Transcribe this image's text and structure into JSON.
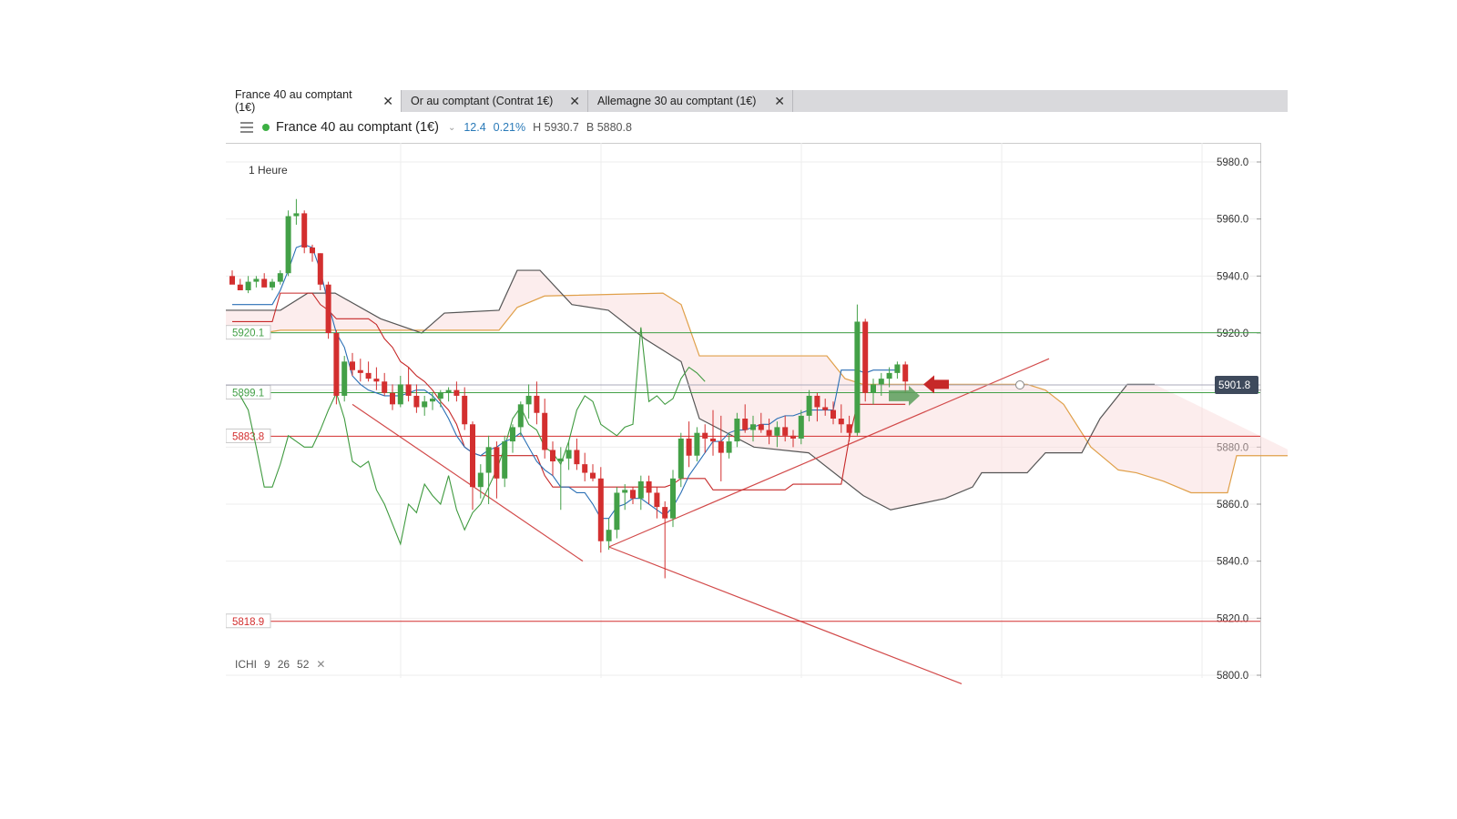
{
  "tabs": [
    {
      "label": "France 40 au comptant (1€)",
      "active": true
    },
    {
      "label": "Or au comptant (Contrat 1€)",
      "active": false
    },
    {
      "label": "Allemagne 30 au comptant (1€)",
      "active": false
    }
  ],
  "toolbar": {
    "symbol": "France 40 au comptant (1€)",
    "change": "12.4",
    "change_pct": "0.21%",
    "high_label": "H",
    "high": "5930.7",
    "bid_label": "B",
    "bid": "5880.8",
    "status_color": "#3cb043"
  },
  "period": "1 Heure",
  "indicator": {
    "name": "ICHI",
    "p1": "9",
    "p2": "26",
    "p3": "52"
  },
  "colors": {
    "up": "#43a047",
    "down": "#d32f2f",
    "accent": "#2a7ab8",
    "price_tag": "#3e4a5c"
  },
  "chart_data": {
    "type": "candlestick",
    "ylim": [
      5800,
      5980
    ],
    "yticks": [
      "5800.0",
      "5820.0",
      "5840.0",
      "5860.0",
      "5880.0",
      "5900.0",
      "5920.0",
      "5940.0",
      "5960.0",
      "5980.0"
    ],
    "current_price": "5901.8",
    "levels": [
      {
        "label": "5920.1",
        "value": 5920.1,
        "color": "#43a047"
      },
      {
        "label": "5899.1",
        "value": 5899.1,
        "color": "#43a047"
      },
      {
        "label": "5883.8",
        "value": 5883.8,
        "color": "#d32f2f"
      },
      {
        "label": "5818.9",
        "value": 5818.9,
        "color": "#d32f2f"
      }
    ],
    "candles": [
      [
        5940,
        5942,
        5938,
        5937
      ],
      [
        5937,
        5939,
        5935,
        5935
      ],
      [
        5935,
        5940,
        5934,
        5938
      ],
      [
        5938,
        5940,
        5936,
        5939
      ],
      [
        5939,
        5941,
        5937,
        5936
      ],
      [
        5936,
        5939,
        5935,
        5938
      ],
      [
        5938,
        5942,
        5937,
        5941
      ],
      [
        5941,
        5963,
        5940,
        5961
      ],
      [
        5961,
        5967,
        5958,
        5962
      ],
      [
        5962,
        5963,
        5948,
        5950
      ],
      [
        5950,
        5951,
        5945,
        5948
      ],
      [
        5948,
        5948,
        5935,
        5937
      ],
      [
        5937,
        5938,
        5918,
        5920
      ],
      [
        5920,
        5921,
        5895,
        5898
      ],
      [
        5898,
        5912,
        5896,
        5910
      ],
      [
        5910,
        5913,
        5905,
        5907
      ],
      [
        5907,
        5911,
        5903,
        5906
      ],
      [
        5906,
        5910,
        5903,
        5904
      ],
      [
        5904,
        5908,
        5900,
        5903
      ],
      [
        5903,
        5906,
        5898,
        5899
      ],
      [
        5899,
        5902,
        5893,
        5895
      ],
      [
        5895,
        5905,
        5894,
        5902
      ],
      [
        5902,
        5908,
        5896,
        5898
      ],
      [
        5898,
        5902,
        5892,
        5894
      ],
      [
        5894,
        5898,
        5891,
        5896
      ],
      [
        5896,
        5899,
        5893,
        5897
      ],
      [
        5897,
        5900,
        5894,
        5899
      ],
      [
        5899,
        5901,
        5896,
        5900
      ],
      [
        5900,
        5903,
        5896,
        5898
      ],
      [
        5898,
        5901,
        5886,
        5888
      ],
      [
        5888,
        5889,
        5858,
        5866
      ],
      [
        5866,
        5874,
        5862,
        5871
      ],
      [
        5871,
        5884,
        5860,
        5880
      ],
      [
        5880,
        5882,
        5862,
        5869
      ],
      [
        5869,
        5884,
        5866,
        5882
      ],
      [
        5882,
        5888,
        5878,
        5887
      ],
      [
        5887,
        5896,
        5884,
        5895
      ],
      [
        5895,
        5902,
        5890,
        5898
      ],
      [
        5898,
        5903,
        5888,
        5892
      ],
      [
        5892,
        5897,
        5876,
        5879
      ],
      [
        5879,
        5882,
        5870,
        5875
      ],
      [
        5875,
        5880,
        5858,
        5876
      ],
      [
        5876,
        5882,
        5872,
        5879
      ],
      [
        5879,
        5883,
        5872,
        5874
      ],
      [
        5874,
        5878,
        5868,
        5871
      ],
      [
        5871,
        5874,
        5868,
        5869
      ],
      [
        5869,
        5873,
        5843,
        5847
      ],
      [
        5847,
        5855,
        5844,
        5851
      ],
      [
        5851,
        5866,
        5848,
        5864
      ],
      [
        5864,
        5867,
        5858,
        5865
      ],
      [
        5865,
        5866,
        5860,
        5862
      ],
      [
        5862,
        5870,
        5858,
        5868
      ],
      [
        5868,
        5870,
        5860,
        5864
      ],
      [
        5864,
        5866,
        5855,
        5859
      ],
      [
        5859,
        5861,
        5834,
        5855
      ],
      [
        5855,
        5872,
        5852,
        5869
      ],
      [
        5869,
        5885,
        5866,
        5883
      ],
      [
        5883,
        5889,
        5873,
        5877
      ],
      [
        5877,
        5887,
        5875,
        5885
      ],
      [
        5885,
        5888,
        5878,
        5883
      ],
      [
        5883,
        5893,
        5877,
        5882
      ],
      [
        5882,
        5891,
        5868,
        5878
      ],
      [
        5878,
        5885,
        5876,
        5882
      ],
      [
        5882,
        5892,
        5880,
        5890
      ],
      [
        5890,
        5895,
        5885,
        5886
      ],
      [
        5886,
        5891,
        5882,
        5888
      ],
      [
        5888,
        5892,
        5885,
        5886
      ],
      [
        5886,
        5890,
        5881,
        5884
      ],
      [
        5884,
        5889,
        5880,
        5887
      ],
      [
        5887,
        5891,
        5882,
        5884
      ],
      [
        5884,
        5886,
        5880,
        5883
      ],
      [
        5883,
        5893,
        5881,
        5891
      ],
      [
        5891,
        5900,
        5889,
        5898
      ],
      [
        5898,
        5899,
        5889,
        5894
      ],
      [
        5894,
        5897,
        5891,
        5893
      ],
      [
        5893,
        5896,
        5888,
        5890
      ],
      [
        5890,
        5895,
        5885,
        5888
      ],
      [
        5888,
        5891,
        5882,
        5885
      ],
      [
        5885,
        5930,
        5884,
        5924
      ],
      [
        5924,
        5925,
        5896,
        5899
      ],
      [
        5899,
        5904,
        5895,
        5902
      ],
      [
        5902,
        5906,
        5898,
        5904
      ],
      [
        5904,
        5908,
        5901,
        5906
      ],
      [
        5906,
        5910,
        5904,
        5909
      ],
      [
        5909,
        5910,
        5899,
        5903
      ]
    ],
    "tenkan": [
      5930,
      5930,
      5930,
      5930,
      5930,
      5930,
      5935,
      5942,
      5950,
      5951,
      5950,
      5942,
      5930,
      5920,
      5915,
      5905,
      5902,
      5900,
      5899,
      5898,
      5898,
      5898,
      5899,
      5900,
      5900,
      5898,
      5895,
      5890,
      5884,
      5880,
      5878,
      5877,
      5879,
      5880,
      5882,
      5883,
      5885,
      5880,
      5875,
      5872,
      5870,
      5866,
      5866,
      5864,
      5864,
      5860,
      5855,
      5855,
      5859,
      5860,
      5862,
      5862,
      5860,
      5858,
      5856,
      5859,
      5864,
      5870,
      5874,
      5878,
      5882,
      5882,
      5885,
      5886,
      5886,
      5887,
      5888,
      5888,
      5890,
      5891,
      5891,
      5892,
      5893,
      5893,
      5893,
      5893,
      5907,
      5907,
      5907,
      5906,
      5907,
      5907,
      5907,
      5907
    ],
    "kijun": [
      5924,
      5924,
      5924,
      5924,
      5924,
      5924,
      5934,
      5934,
      5934,
      5934,
      5934,
      5930,
      5928,
      5925,
      5925,
      5925,
      5925,
      5925,
      5923,
      5918,
      5915,
      5910,
      5908,
      5905,
      5903,
      5900,
      5896,
      5893,
      5888,
      5880,
      5878,
      5877,
      5877,
      5877,
      5877,
      5877,
      5877,
      5877,
      5877,
      5870,
      5866,
      5866,
      5866,
      5866,
      5866,
      5866,
      5866,
      5866,
      5866,
      5866,
      5866,
      5866,
      5866,
      5866,
      5866,
      5867,
      5869,
      5869,
      5869,
      5869,
      5865,
      5865,
      5865,
      5865,
      5865,
      5865,
      5865,
      5865,
      5865,
      5865,
      5867,
      5867,
      5867,
      5867,
      5867,
      5867,
      5867,
      5883,
      5895,
      5895,
      5895,
      5895,
      5895,
      5895,
      5895
    ],
    "chikou": [
      5898,
      5893,
      5880,
      5866,
      5866,
      5874,
      5884,
      5882,
      5880,
      5880,
      5886,
      5893,
      5899,
      5890,
      5875,
      5873,
      5875,
      5865,
      5860,
      5853,
      5846,
      5860,
      5857,
      5867,
      5863,
      5860,
      5870,
      5858,
      5851,
      5857,
      5860,
      5866,
      5872,
      5880,
      5890,
      5894,
      5888,
      5886,
      5880,
      5878,
      5874,
      5882,
      5893,
      5898,
      5896,
      5888,
      5886,
      5884,
      5887,
      5888,
      5922,
      5896,
      5898,
      5895,
      5897,
      5904,
      5908,
      5906,
      5903
    ]
  }
}
